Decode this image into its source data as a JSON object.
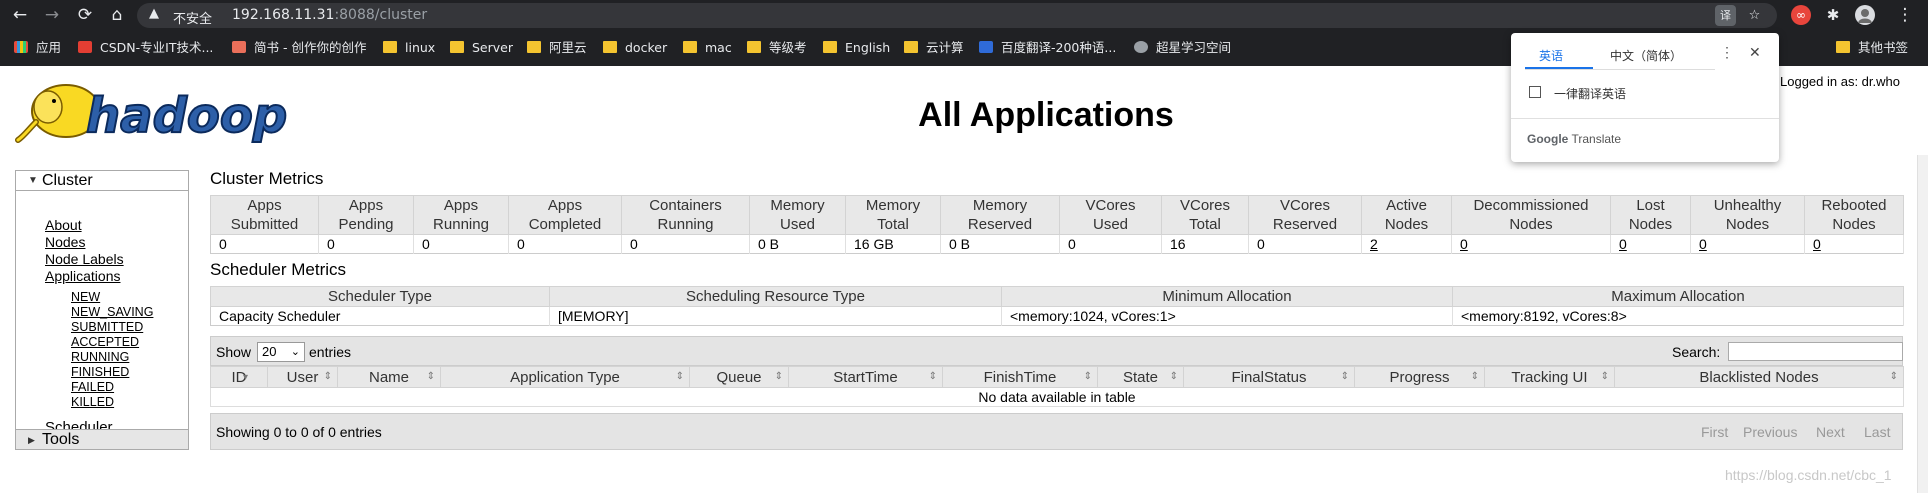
{
  "browser": {
    "nav_back_icon": "←",
    "nav_forward_icon": "→",
    "reload_icon": "⟳",
    "home_icon": "⌂",
    "security_icon": "▲",
    "security_label": "不安全",
    "url_host": "192.168.11.31",
    "url_rest": ":8088/cluster",
    "translate_icon": "译",
    "star_icon": "☆",
    "menu_icon": "⋮",
    "bookmarks": [
      {
        "label": "应用",
        "icon": "apps-grid-icon"
      },
      {
        "label": "CSDN-专业IT技术...",
        "icon": "csdn-icon"
      },
      {
        "label": "简书 - 创作你的创作",
        "icon": "jianshu-icon"
      },
      {
        "label": "linux",
        "icon": "folder-icon"
      },
      {
        "label": "Server",
        "icon": "folder-icon"
      },
      {
        "label": "阿里云",
        "icon": "folder-icon"
      },
      {
        "label": "docker",
        "icon": "folder-icon"
      },
      {
        "label": "mac",
        "icon": "folder-icon"
      },
      {
        "label": "等级考",
        "icon": "folder-icon"
      },
      {
        "label": "English",
        "icon": "folder-icon"
      },
      {
        "label": "云计算",
        "icon": "folder-icon"
      },
      {
        "label": "百度翻译-200种语...",
        "icon": "baidu-translate-icon"
      },
      {
        "label": "超星学习空间",
        "icon": "globe-icon"
      }
    ],
    "other_bookmarks": "其他书签"
  },
  "translate_popup": {
    "tab_source": "英语",
    "tab_target": "中文（简体）",
    "more_icon": "⋮",
    "close_icon": "✕",
    "always_translate_label": "一律翻译英语",
    "brand_google": "Google",
    "brand_translate": "Translate"
  },
  "header": {
    "logo_text": "hadoop",
    "title": "All Applications",
    "logged_in": "Logged in as: dr.who"
  },
  "nav": {
    "cluster_label": "Cluster",
    "cluster_links": [
      "About",
      "Nodes",
      "Node Labels",
      "Applications"
    ],
    "app_states": [
      "NEW",
      "NEW_SAVING",
      "SUBMITTED",
      "ACCEPTED",
      "RUNNING",
      "FINISHED",
      "FAILED",
      "KILLED"
    ],
    "scheduler_link": "Scheduler",
    "tools_label": "Tools"
  },
  "cluster_metrics": {
    "title": "Cluster Metrics",
    "headers": [
      [
        "Apps",
        "Submitted"
      ],
      [
        "Apps",
        "Pending"
      ],
      [
        "Apps",
        "Running"
      ],
      [
        "Apps",
        "Completed"
      ],
      [
        "Containers",
        "Running"
      ],
      [
        "Memory",
        "Used"
      ],
      [
        "Memory",
        "Total"
      ],
      [
        "Memory",
        "Reserved"
      ],
      [
        "VCores",
        "Used"
      ],
      [
        "VCores",
        "Total"
      ],
      [
        "VCores",
        "Reserved"
      ],
      [
        "Active",
        "Nodes"
      ],
      [
        "Decommissioned",
        "Nodes"
      ],
      [
        "Lost",
        "Nodes"
      ],
      [
        "Unhealthy",
        "Nodes"
      ],
      [
        "Rebooted",
        "Nodes"
      ]
    ],
    "values": [
      "0",
      "0",
      "0",
      "0",
      "0",
      "0 B",
      "16 GB",
      "0 B",
      "0",
      "16",
      "0",
      "2",
      "0",
      "0",
      "0",
      "0"
    ]
  },
  "scheduler_metrics": {
    "title": "Scheduler Metrics",
    "headers": [
      "Scheduler Type",
      "Scheduling Resource Type",
      "Minimum Allocation",
      "Maximum Allocation"
    ],
    "values": [
      "Capacity Scheduler",
      "[MEMORY]",
      "<memory:1024, vCores:1>",
      "<memory:8192, vCores:8>"
    ]
  },
  "applications": {
    "show_label": "Show",
    "entries_label": "entries",
    "page_size": "20",
    "search_label": "Search:",
    "search_value": "",
    "columns": [
      "ID",
      "User",
      "Name",
      "Application Type",
      "Queue",
      "StartTime",
      "FinishTime",
      "State",
      "FinalStatus",
      "Progress",
      "Tracking UI",
      "Blacklisted Nodes"
    ],
    "empty_message": "No data available in table",
    "info": "Showing 0 to 0 of 0 entries",
    "pager": [
      "First",
      "Previous",
      "Next",
      "Last"
    ],
    "sort_icon_active": "▾",
    "sort_icon": "⇕"
  },
  "watermark": "https://blog.csdn.net/cbc_1"
}
